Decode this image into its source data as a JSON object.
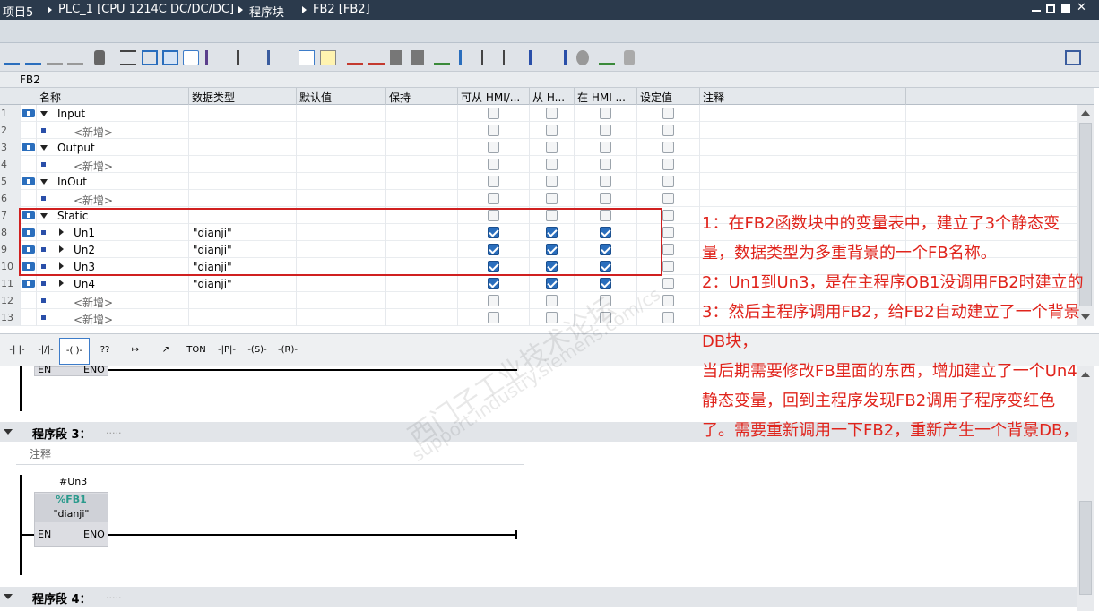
{
  "titlebar": {
    "crumbs": [
      "项目5",
      "PLC_1 [CPU 1214C DC/DC/DC]",
      "程序块",
      "FB2 [FB2]"
    ]
  },
  "block_name": "FB2",
  "table": {
    "headers": [
      "名称",
      "数据类型",
      "默认值",
      "保持",
      "可从 HMI/...",
      "从 H...",
      "在 HMI ...",
      "设定值",
      "注释"
    ],
    "rows": [
      {
        "num": "1",
        "kind": "section",
        "name": "Input",
        "type": "",
        "checks": [
          false,
          false,
          false,
          false
        ]
      },
      {
        "num": "2",
        "kind": "add",
        "name": "<新增>",
        "type": "",
        "checks": [
          false,
          false,
          false,
          false
        ]
      },
      {
        "num": "3",
        "kind": "section",
        "name": "Output",
        "type": "",
        "checks": [
          false,
          false,
          false,
          false
        ]
      },
      {
        "num": "4",
        "kind": "add",
        "name": "<新增>",
        "type": "",
        "checks": [
          false,
          false,
          false,
          false
        ]
      },
      {
        "num": "5",
        "kind": "section",
        "name": "InOut",
        "type": "",
        "checks": [
          false,
          false,
          false,
          false
        ]
      },
      {
        "num": "6",
        "kind": "add",
        "name": "<新增>",
        "type": "",
        "checks": [
          false,
          false,
          false,
          false
        ]
      },
      {
        "num": "7",
        "kind": "section",
        "name": "Static",
        "type": "",
        "checks": [
          false,
          false,
          false,
          false
        ]
      },
      {
        "num": "8",
        "kind": "member",
        "name": "Un1",
        "type": "\"dianji\"",
        "checks": [
          true,
          true,
          true,
          false
        ]
      },
      {
        "num": "9",
        "kind": "member",
        "name": "Un2",
        "type": "\"dianji\"",
        "checks": [
          true,
          true,
          true,
          false
        ]
      },
      {
        "num": "10",
        "kind": "member",
        "name": "Un3",
        "type": "\"dianji\"",
        "checks": [
          true,
          true,
          true,
          false
        ]
      },
      {
        "num": "11",
        "kind": "member",
        "name": "Un4",
        "type": "\"dianji\"",
        "checks": [
          true,
          true,
          true,
          false
        ]
      },
      {
        "num": "12",
        "kind": "add",
        "name": "<新增>",
        "type": "",
        "checks": [
          false,
          false,
          false,
          false
        ]
      },
      {
        "num": "13",
        "kind": "add",
        "name": "<新增>",
        "type": "",
        "checks": [
          false,
          false,
          false,
          false
        ]
      }
    ]
  },
  "palette": [
    "-| |-",
    "-|/|-",
    "-( )-",
    "??",
    "↦",
    "↗",
    "TON",
    "-|P|-",
    "-(S)-",
    "-(R)-"
  ],
  "ladder": {
    "net1_en": "EN",
    "net1_eno": "ENO",
    "net3_title": "程序段 3：",
    "net3_dots": ".....",
    "comment_label": "注释",
    "instance": "#Un3",
    "fb_addr": "%FB1",
    "fb_name": "\"dianji\"",
    "en": "EN",
    "eno": "ENO",
    "net4_title": "程序段 4：",
    "net4_dots": "....."
  },
  "annotation": {
    "lines": [
      "1：在FB2函数块中的变量表中，建立了3个静态变量，数据类型为多重背景的一个FB名称。",
      "2：Un1到Un3，是在主程序OB1没调用FB2时建立的",
      "3：然后主程序调用FB2，给FB2自动建立了一个背景DB块，",
      "当后期需要修改FB里面的东西，增加建立了一个Un4静态变量，回到主程序发现FB2调用子程序变红色了。需要重新调用一下FB2，重新产生一个背景DB，"
    ]
  },
  "watermark": {
    "cn": "西门子工业技术论坛",
    "url": "support.industry.siemens.com/cs"
  },
  "colors": {
    "annotation": "#e0241c",
    "highlight": "#d02020",
    "fb_addr": "#2a9a8c",
    "check_on": "#2a6ebd"
  }
}
